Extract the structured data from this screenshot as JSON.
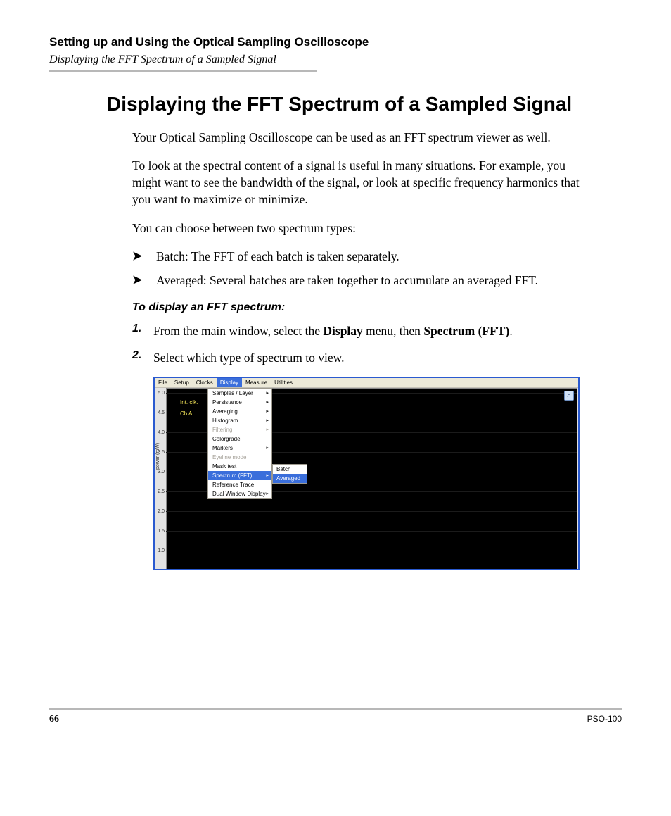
{
  "header": {
    "chapter": "Setting up and Using the Optical Sampling Oscilloscope",
    "section_running": "Displaying the FFT Spectrum of a Sampled Signal"
  },
  "title": "Displaying the FFT Spectrum of a Sampled Signal",
  "paragraphs": {
    "p1": "Your Optical Sampling Oscilloscope can be used as an FFT spectrum viewer as well.",
    "p2": "To look at the spectral content of a signal is useful in many situations. For example, you might want to see the bandwidth of the signal, or look at specific frequency harmonics that you want to maximize or minimize.",
    "p3": "You can choose between two spectrum types:"
  },
  "bullets": [
    "Batch: The FFT of each batch is taken separately.",
    "Averaged: Several batches are taken together to accumulate an averaged FFT."
  ],
  "instructions": {
    "heading": "To display an FFT spectrum:",
    "steps": [
      {
        "num": "1.",
        "pre": "From the main window, select the ",
        "b1": "Display",
        "mid": " menu, then ",
        "b2": "Spectrum (FFT)",
        "post": "."
      },
      {
        "num": "2.",
        "pre": "Select which type of spectrum to view.",
        "b1": "",
        "mid": "",
        "b2": "",
        "post": ""
      }
    ]
  },
  "screenshot": {
    "menubar": [
      "File",
      "Setup",
      "Clocks",
      "Display",
      "Measure",
      "Utilities"
    ],
    "menubar_active": "Display",
    "y_axis_label": "power (mW)",
    "y_ticks": [
      "5.0",
      "4.5",
      "4.0",
      "3.5",
      "3.0",
      "2.5",
      "2.0",
      "1.5",
      "1.0"
    ],
    "channel_labels": [
      "Int. clk.",
      "Ch A"
    ],
    "display_menu": [
      {
        "label": "Samples / Layer",
        "arrow": true
      },
      {
        "label": "Persistance",
        "arrow": true
      },
      {
        "label": "Averaging",
        "arrow": true
      },
      {
        "label": "Histogram",
        "arrow": true
      },
      {
        "label": "Filtering",
        "arrow": true,
        "disabled": true
      },
      {
        "label": "Colorgrade",
        "arrow": false
      },
      {
        "label": "Markers",
        "arrow": true
      },
      {
        "label": "Eyeline mode",
        "arrow": false,
        "disabled": true
      },
      {
        "label": "Mask test",
        "arrow": false
      },
      {
        "label": "Spectrum (FFT)",
        "arrow": true,
        "selected": true
      },
      {
        "label": "Reference Trace",
        "arrow": false
      },
      {
        "label": "Dual Window Display",
        "arrow": true
      }
    ],
    "spectrum_submenu": [
      {
        "label": "Batch"
      },
      {
        "label": "Averaged",
        "selected": true
      }
    ]
  },
  "footer": {
    "page": "66",
    "model": "PSO-100"
  }
}
